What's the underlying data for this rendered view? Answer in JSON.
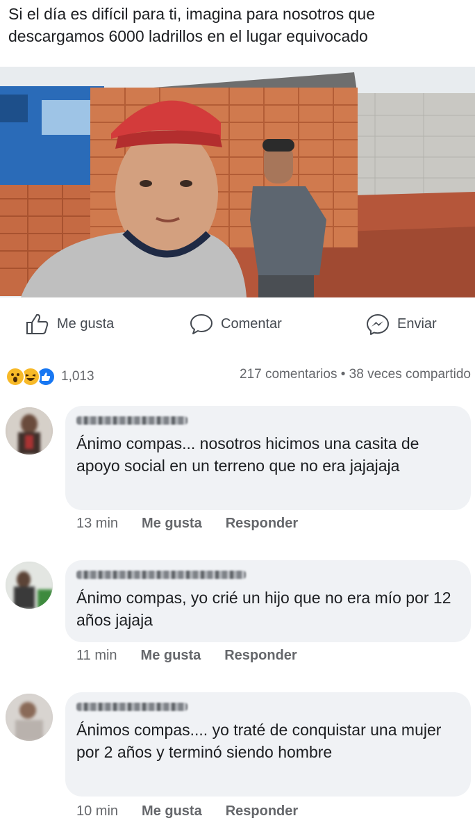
{
  "post": {
    "text": "Si el día es difícil para ti, imagina para nosotros que descargamos 6000 ladrillos en el lugar equivocado"
  },
  "actions": {
    "like_label": "Me gusta",
    "comment_label": "Comentar",
    "send_label": "Enviar"
  },
  "stats": {
    "reaction_count": "1,013",
    "comments_shares": "217 comentarios • 38 veces compartido",
    "reaction_icons": [
      "wow-icon",
      "haha-icon",
      "like-icon"
    ]
  },
  "comments": [
    {
      "text": "Ánimo compas... nosotros hicimos una casita de apoyo social en un terreno que no era jajajaja",
      "time": "13 min",
      "like_label": "Me gusta",
      "reply_label": "Responder"
    },
    {
      "text": "Ánimo compas, yo crié un hijo que no era mío por 12 años jajaja",
      "time": "11 min",
      "like_label": "Me gusta",
      "reply_label": "Responder"
    },
    {
      "text": "Ánimos compas.... yo traté de conquistar una mujer por 2 años y terminó siendo hombre",
      "time": "10 min",
      "like_label": "Me gusta",
      "reply_label": "Responder"
    }
  ],
  "colors": {
    "text": "#1c1e21",
    "secondary": "#65676b",
    "bubble": "#f0f2f5",
    "messenger": "#0084ff"
  }
}
